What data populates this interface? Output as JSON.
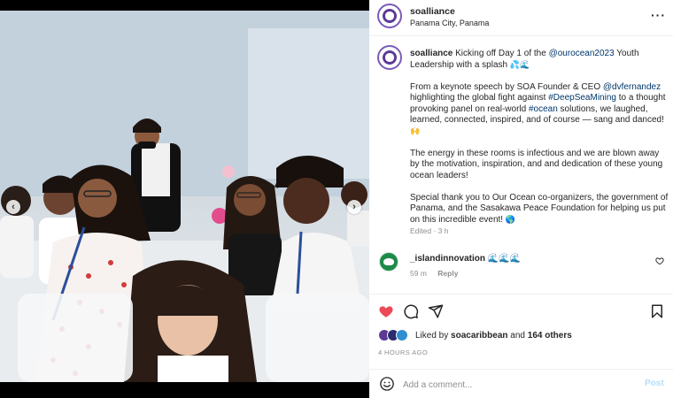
{
  "post": {
    "username": "soalliance",
    "location": "Panama City, Panama",
    "more_icon": "more-horizontal-icon"
  },
  "caption": {
    "username": "soalliance",
    "p1_text1": " Kicking off Day 1 of the ",
    "p1_mention": "@ourocean2023",
    "p1_text2": " Youth Leadership with a splash ",
    "p1_emoji": "💦🌊",
    "p2_text1": "From a keynote speech by SOA Founder & CEO ",
    "p2_mention": "@dvfernandez",
    "p2_text2": " highlighting the global fight against ",
    "p2_tag1": "#DeepSeaMining",
    "p2_text3": " to a thought provoking panel on real-world ",
    "p2_tag2": "#ocean",
    "p2_text4": " solutions, we laughed, learned, connected, inspired, and of course — sang and danced! ",
    "p2_emoji": "🙌",
    "p3": "The energy in these rooms is infectious and we are blown away by the motivation, inspiration, and and dedication of these young ocean leaders!",
    "p4_text": "Special thank you to Our Ocean co-organizers, the government of Panama, and the Sasakawa Peace Foundation for helping us put on this incredible event! ",
    "p4_emoji": "🌎",
    "meta": "Edited · 3 h"
  },
  "comment": {
    "username": "_islandinnovation",
    "text": " 🌊🌊🌊",
    "time": "59 m",
    "reply": "Reply"
  },
  "likes": {
    "prefix": "Liked by ",
    "user": "soacaribbean",
    "middle": " and ",
    "count": "164 others"
  },
  "time_ago": "4 HOURS AGO",
  "add_comment": {
    "placeholder": "Add a comment...",
    "post_label": "Post"
  },
  "carousel": {
    "slide_count": 8,
    "active_index": 0
  },
  "colors": {
    "link": "#00376b",
    "like_red": "#ed4956",
    "muted": "#8e8e8e",
    "post_disabled": "#b2dffc"
  }
}
